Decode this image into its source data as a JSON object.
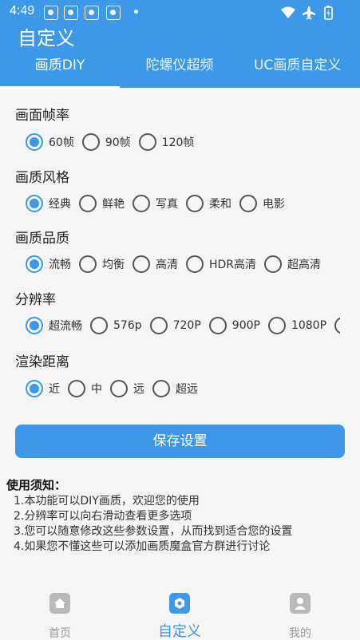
{
  "status_bar": {
    "time": "4:49"
  },
  "app_bar": {
    "title": "自定义"
  },
  "tabs": [
    {
      "label": "画质DIY",
      "active": true
    },
    {
      "label": "陀螺仪超频",
      "active": false
    },
    {
      "label": "UC画质自定义",
      "active": false
    }
  ],
  "sections": [
    {
      "title": "画面帧率",
      "options": [
        "60帧",
        "90帧",
        "120帧"
      ],
      "selected": 0
    },
    {
      "title": "画质风格",
      "options": [
        "经典",
        "鲜艳",
        "写真",
        "柔和",
        "电影"
      ],
      "selected": 0
    },
    {
      "title": "画质品质",
      "options": [
        "流畅",
        "均衡",
        "高清",
        "HDR高清",
        "超高清"
      ],
      "selected": 0
    },
    {
      "title": "分辨率",
      "options": [
        "超流畅",
        "576p",
        "720P",
        "900P",
        "1080P"
      ],
      "selected": 0
    },
    {
      "title": "渲染距离",
      "options": [
        "近",
        "中",
        "远",
        "超远"
      ],
      "selected": 0
    }
  ],
  "save_button": {
    "label": "保存设置"
  },
  "notes": {
    "title": "使用须知：",
    "lines": [
      "1.本功能可以DIY画质，欢迎您的使用",
      "2.分辨率可以向右滑动查看更多选项",
      "3.您可以随意修改这些参数设置，从而找到适合您的设置",
      "4.如果您不懂这些可以添加画质魔盒官方群进行讨论"
    ]
  },
  "bottom_nav": [
    {
      "label": "首页",
      "icon": "home-icon",
      "active": false
    },
    {
      "label": "自定义",
      "icon": "customize-icon",
      "active": true
    },
    {
      "label": "我的",
      "icon": "profile-icon",
      "active": false
    }
  ],
  "colors": {
    "accent": "#3d98ea",
    "background": "#f5f5f5"
  }
}
